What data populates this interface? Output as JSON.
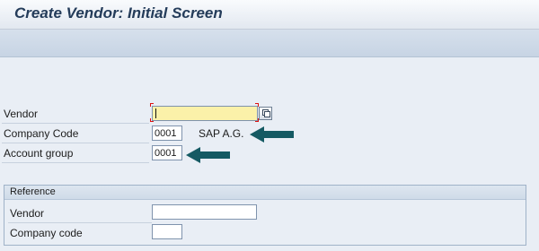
{
  "window": {
    "title": "Create Vendor:  Initial Screen"
  },
  "form": {
    "vendor_label": "Vendor",
    "vendor_value": "",
    "company_code_label": "Company Code",
    "company_code_value": "0001",
    "company_name": "SAP A.G.",
    "account_group_label": "Account group",
    "account_group_value": "0001"
  },
  "reference": {
    "title": "Reference",
    "vendor_label": "Vendor",
    "vendor_value": "",
    "company_code_label": "Company code",
    "company_code_value": ""
  },
  "colors": {
    "arrow": "#155a63",
    "required_field": "#fbf1a9",
    "title_text": "#243c5a"
  },
  "icons": {
    "search_help": "f4-search-help-icon",
    "annotation": "arrow-left-icon"
  }
}
